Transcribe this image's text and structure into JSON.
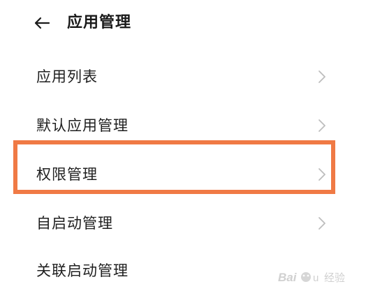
{
  "header": {
    "back_icon": "arrow-left-icon",
    "title": "应用管理"
  },
  "menu": {
    "items": [
      {
        "label": "应用列表",
        "icon": "chevron-right-icon",
        "highlighted": false
      },
      {
        "label": "默认应用管理",
        "icon": "chevron-right-icon",
        "highlighted": false
      },
      {
        "label": "权限管理",
        "icon": "chevron-right-icon",
        "highlighted": true
      },
      {
        "label": "自启动管理",
        "icon": "chevron-right-icon",
        "highlighted": false
      },
      {
        "label": "关联启动管理",
        "icon": "chevron-right-icon",
        "highlighted": false
      }
    ]
  },
  "colors": {
    "highlight": "#f07a45",
    "text": "#1f1f1f",
    "chevron": "#bdbdbd"
  },
  "watermark": {
    "text": "Baidu 经验"
  }
}
